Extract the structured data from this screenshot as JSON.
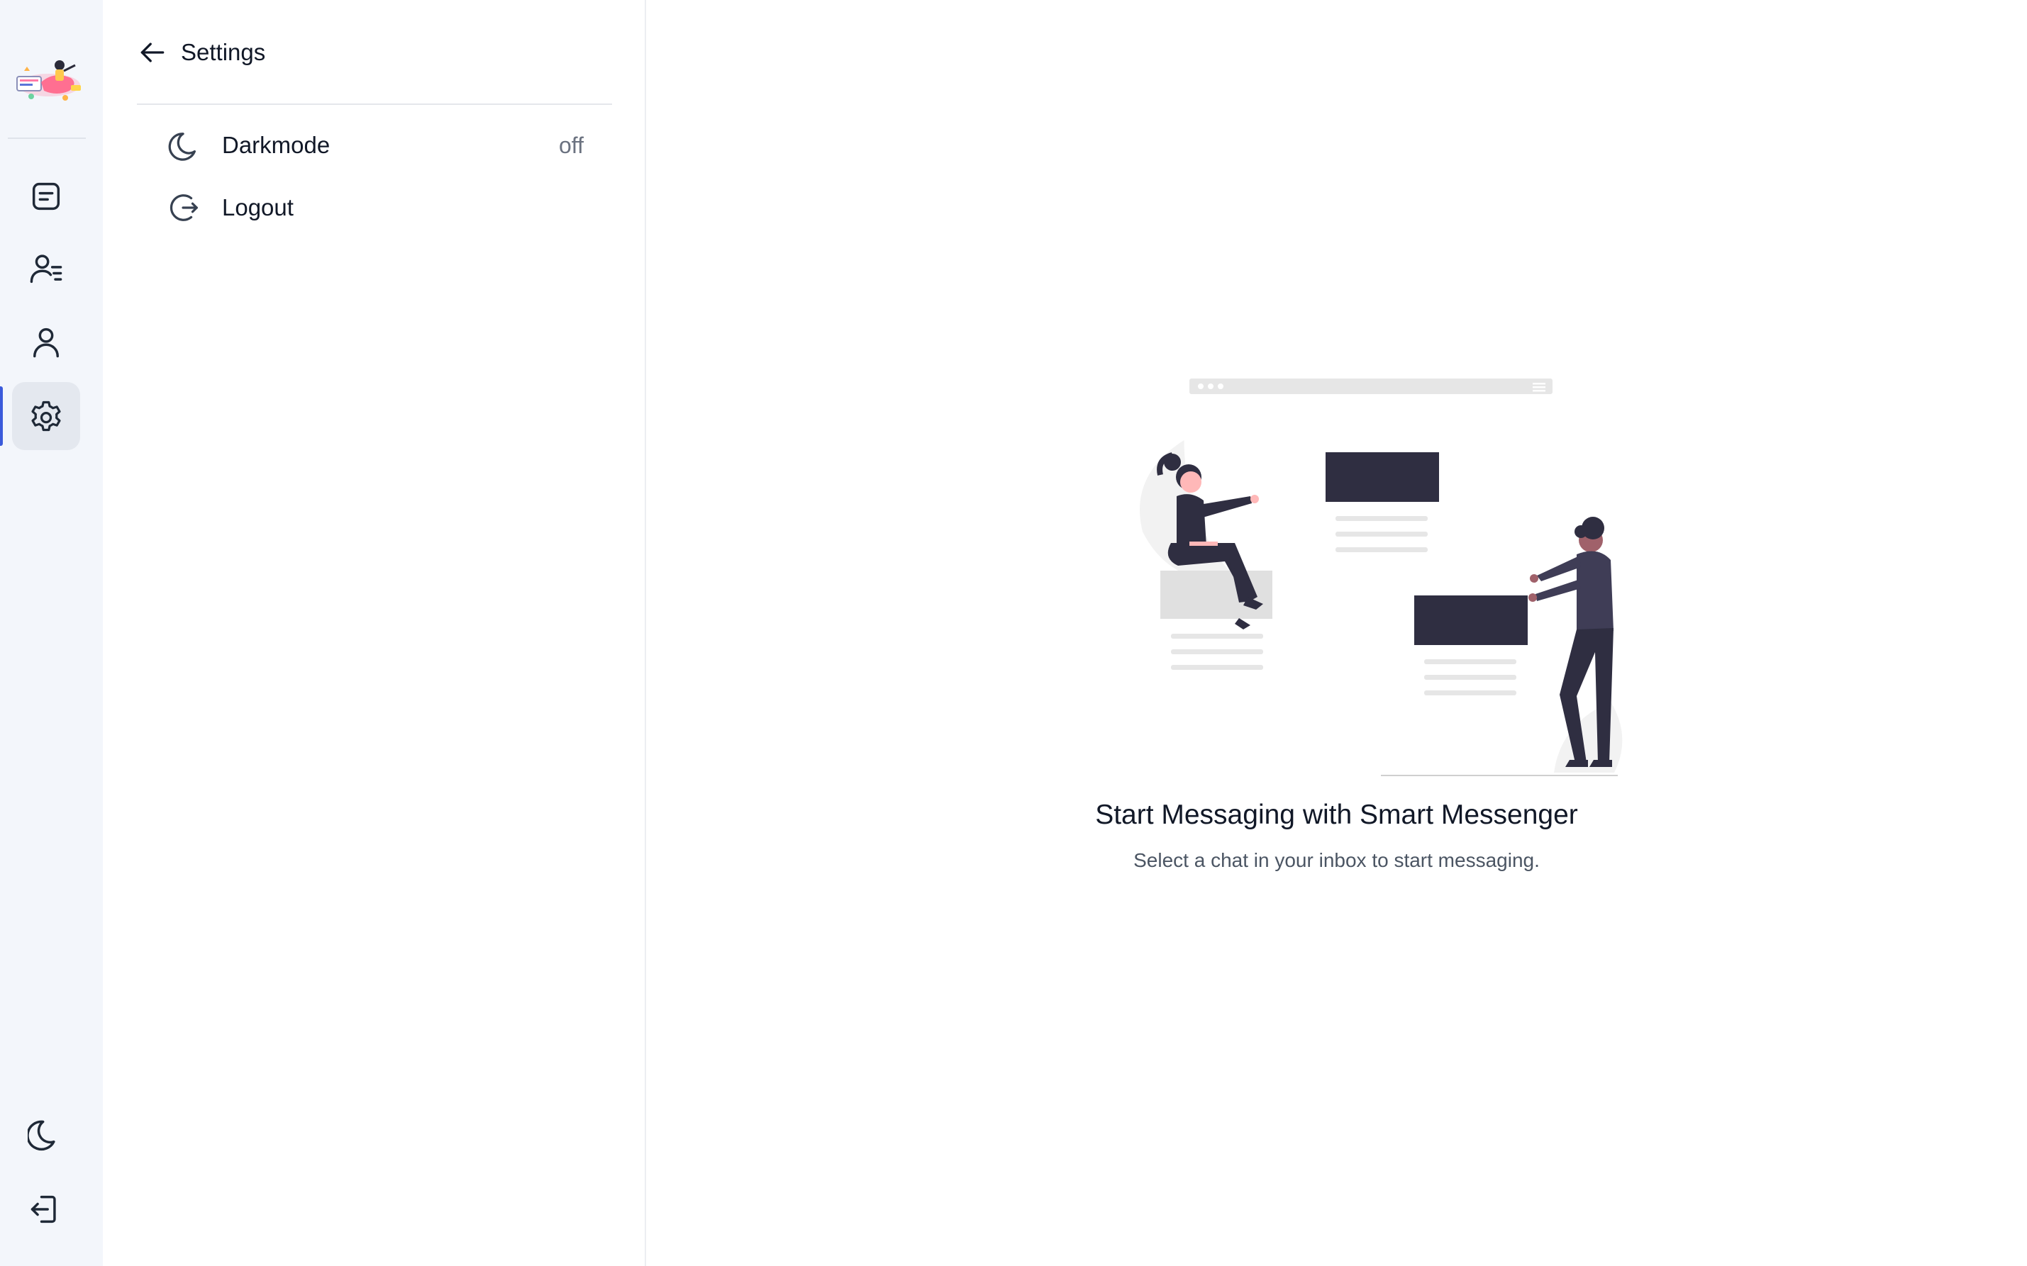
{
  "app": {
    "logo_name": "app-logo"
  },
  "rail": {
    "items": [
      {
        "name": "chats",
        "icon": "chat-icon",
        "active": false
      },
      {
        "name": "contacts",
        "icon": "contacts-list-icon",
        "active": false
      },
      {
        "name": "profile",
        "icon": "user-icon",
        "active": false
      },
      {
        "name": "settings",
        "icon": "gear-icon",
        "active": true
      }
    ],
    "bottom": [
      {
        "name": "darkmode",
        "icon": "moon-icon"
      },
      {
        "name": "logout",
        "icon": "logout-icon"
      }
    ],
    "accent_color": "#3b5bdb"
  },
  "settings": {
    "title": "Settings",
    "back_icon": "arrow-left-icon",
    "items": [
      {
        "label": "Darkmode",
        "icon": "moon-icon",
        "value": "off"
      },
      {
        "label": "Logout",
        "icon": "logout-circle-icon",
        "value": ""
      }
    ]
  },
  "empty_state": {
    "title": "Start Messaging with Smart Messenger",
    "subtitle": "Select a chat in your inbox to start messaging."
  }
}
